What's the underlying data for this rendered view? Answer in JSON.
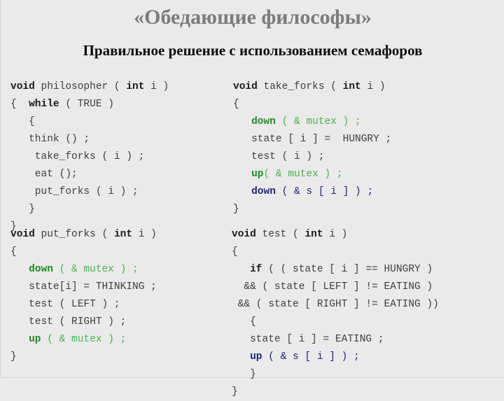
{
  "slide": {
    "title": "«Обедающие философы»",
    "subtitle": "Правильное решение с использованием семафоров",
    "background_color": "#eaeaea",
    "title_color": "#7c7c7c",
    "subtitle_color": "#0b0b0b"
  },
  "colors": {
    "keyword": "#1a1a1a",
    "plain": "#3f3f3f",
    "green_bold": "#1f8a24",
    "green_light": "#4fb04f",
    "blue": "#23237a"
  },
  "code_blocks": {
    "philosopher": {
      "name": "philosopher",
      "lines": [
        {
          "tokens": [
            {
              "t": "void",
              "c": "kw"
            },
            {
              "t": " philosopher ( ",
              "c": "plain"
            },
            {
              "t": "int",
              "c": "kw"
            },
            {
              "t": " i )",
              "c": "plain"
            }
          ]
        },
        {
          "tokens": [
            {
              "t": "{  ",
              "c": "plain"
            },
            {
              "t": "while",
              "c": "kw"
            },
            {
              "t": " ( TRUE )",
              "c": "plain"
            }
          ]
        },
        {
          "tokens": [
            {
              "t": "   {",
              "c": "plain"
            }
          ]
        },
        {
          "tokens": [
            {
              "t": "   think () ;",
              "c": "plain"
            }
          ]
        },
        {
          "tokens": [
            {
              "t": "    take_forks ( i ) ;",
              "c": "plain"
            }
          ]
        },
        {
          "tokens": [
            {
              "t": "    eat ();",
              "c": "plain"
            }
          ]
        },
        {
          "tokens": [
            {
              "t": "    put_forks ( i ) ;",
              "c": "plain"
            }
          ]
        },
        {
          "tokens": [
            {
              "t": "   }",
              "c": "plain"
            }
          ]
        },
        {
          "tokens": [
            {
              "t": "}",
              "c": "plain"
            }
          ]
        }
      ]
    },
    "take_forks": {
      "name": "take_forks",
      "lines": [
        {
          "tokens": [
            {
              "t": "void",
              "c": "kw"
            },
            {
              "t": " take_forks ( ",
              "c": "plain"
            },
            {
              "t": "int",
              "c": "kw"
            },
            {
              "t": " i )",
              "c": "plain"
            }
          ]
        },
        {
          "tokens": [
            {
              "t": "{",
              "c": "plain"
            }
          ]
        },
        {
          "tokens": [
            {
              "t": "   ",
              "c": "plain"
            },
            {
              "t": "down",
              "c": "gdark"
            },
            {
              "t": " ( & mutex ) ;",
              "c": "glite"
            }
          ]
        },
        {
          "tokens": [
            {
              "t": "   state [ i ] =  HUNGRY ;",
              "c": "plain"
            }
          ]
        },
        {
          "tokens": [
            {
              "t": "   test ( i ) ;",
              "c": "plain"
            }
          ]
        },
        {
          "tokens": [
            {
              "t": "   ",
              "c": "plain"
            },
            {
              "t": "up",
              "c": "gdark"
            },
            {
              "t": "( & mutex ) ;",
              "c": "glite"
            }
          ]
        },
        {
          "tokens": [
            {
              "t": "   ",
              "c": "plain"
            },
            {
              "t": "down",
              "c": "blue"
            },
            {
              "t": " ( & s [ i ] ) ;",
              "c": "bluet"
            }
          ]
        },
        {
          "tokens": [
            {
              "t": "}",
              "c": "plain"
            }
          ]
        }
      ]
    },
    "put_forks": {
      "name": "put_forks",
      "lines": [
        {
          "tokens": [
            {
              "t": "void",
              "c": "kw"
            },
            {
              "t": " put_forks ( ",
              "c": "plain"
            },
            {
              "t": "int",
              "c": "kw"
            },
            {
              "t": " i )",
              "c": "plain"
            }
          ]
        },
        {
          "tokens": [
            {
              "t": "{",
              "c": "plain"
            }
          ]
        },
        {
          "tokens": [
            {
              "t": "   ",
              "c": "plain"
            },
            {
              "t": "down",
              "c": "gdark"
            },
            {
              "t": " ( & mutex ) ;",
              "c": "glite"
            }
          ]
        },
        {
          "tokens": [
            {
              "t": "   state[i] = THINKING ;",
              "c": "plain"
            }
          ]
        },
        {
          "tokens": [
            {
              "t": "   test ( LEFT ) ;",
              "c": "plain"
            }
          ]
        },
        {
          "tokens": [
            {
              "t": "   test ( RIGHT ) ;",
              "c": "plain"
            }
          ]
        },
        {
          "tokens": [
            {
              "t": "   ",
              "c": "plain"
            },
            {
              "t": "up",
              "c": "gdark"
            },
            {
              "t": " ( & mutex ) ;",
              "c": "glite"
            }
          ]
        },
        {
          "tokens": [
            {
              "t": "}",
              "c": "plain"
            }
          ]
        }
      ]
    },
    "test": {
      "name": "test",
      "lines": [
        {
          "tokens": [
            {
              "t": "void",
              "c": "kw"
            },
            {
              "t": " test ( ",
              "c": "plain"
            },
            {
              "t": "int",
              "c": "kw"
            },
            {
              "t": " i )",
              "c": "plain"
            }
          ]
        },
        {
          "tokens": [
            {
              "t": "{",
              "c": "plain"
            }
          ]
        },
        {
          "tokens": [
            {
              "t": "   ",
              "c": "plain"
            },
            {
              "t": "if",
              "c": "kw"
            },
            {
              "t": " ( ( state [ i ] == HUNGRY )",
              "c": "plain"
            }
          ]
        },
        {
          "tokens": [
            {
              "t": "  && ( state [ LEFT ] != EATING )",
              "c": "plain"
            }
          ]
        },
        {
          "tokens": [
            {
              "t": " && ( state [ RIGHT ] != EATING ))",
              "c": "plain"
            }
          ]
        },
        {
          "tokens": [
            {
              "t": "   {",
              "c": "plain"
            }
          ]
        },
        {
          "tokens": [
            {
              "t": "   state [ i ] = EATING ;",
              "c": "plain"
            }
          ]
        },
        {
          "tokens": [
            {
              "t": "   ",
              "c": "plain"
            },
            {
              "t": "up",
              "c": "blue"
            },
            {
              "t": " ( & s [ i ] ) ;",
              "c": "bluet"
            }
          ]
        },
        {
          "tokens": [
            {
              "t": "   }",
              "c": "plain"
            }
          ]
        },
        {
          "tokens": [
            {
              "t": "}",
              "c": "plain"
            }
          ]
        }
      ]
    }
  }
}
